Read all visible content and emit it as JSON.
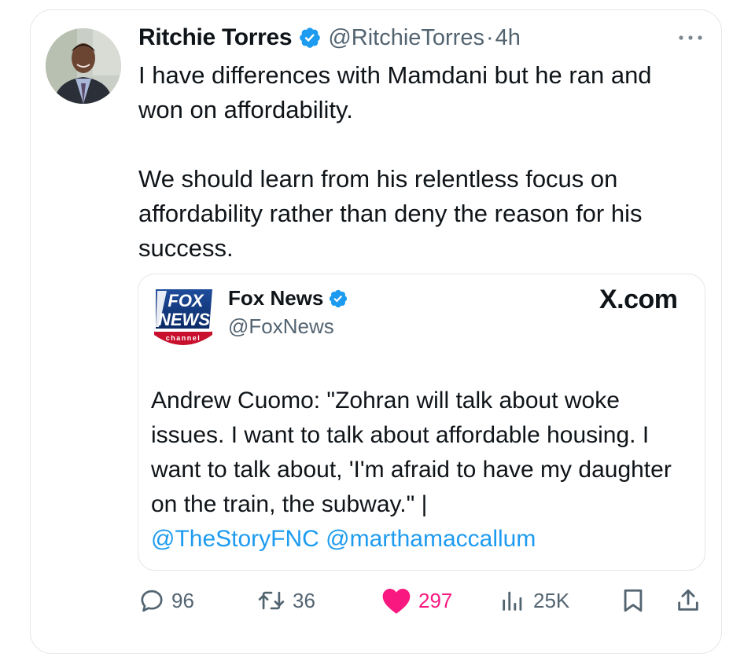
{
  "tweet": {
    "display_name": "Ritchie Torres",
    "handle": "@RitchieTorres",
    "separator": "·",
    "time": "4h",
    "text": "I have differences with Mamdani but he ran and\nwon on affordability.\n\nWe should learn from his relentless focus on\naffordability rather than deny the reason for his\nsuccess.",
    "icons": {
      "avatar": "avatar",
      "verified": "verified-badge-icon",
      "more": "more-icon"
    }
  },
  "quote": {
    "display_name": "Fox News",
    "handle": "@FoxNews",
    "source": "X.com",
    "logo": {
      "line1": "FOX",
      "line2": "NEWS",
      "line3": "channel"
    },
    "text_part": "Andrew Cuomo: \"Zohran will talk about woke issues. I want to talk about affordable housing. I want to talk about, 'I'm afraid to have my daughter on the train, the subway.\" |",
    "mention1": "@TheStoryFNC",
    "mention2": "@marthamaccallum"
  },
  "actions": {
    "replies": "96",
    "reposts": "36",
    "likes": "297",
    "views": "25K",
    "icons": [
      "reply-icon",
      "repost-icon",
      "like-icon",
      "views-icon",
      "bookmark-icon",
      "share-icon"
    ]
  },
  "colors": {
    "text": "#0f1419",
    "secondary": "#536471",
    "accent": "#1d9bf0",
    "like": "#f91880",
    "border": "#e3e6e9"
  }
}
